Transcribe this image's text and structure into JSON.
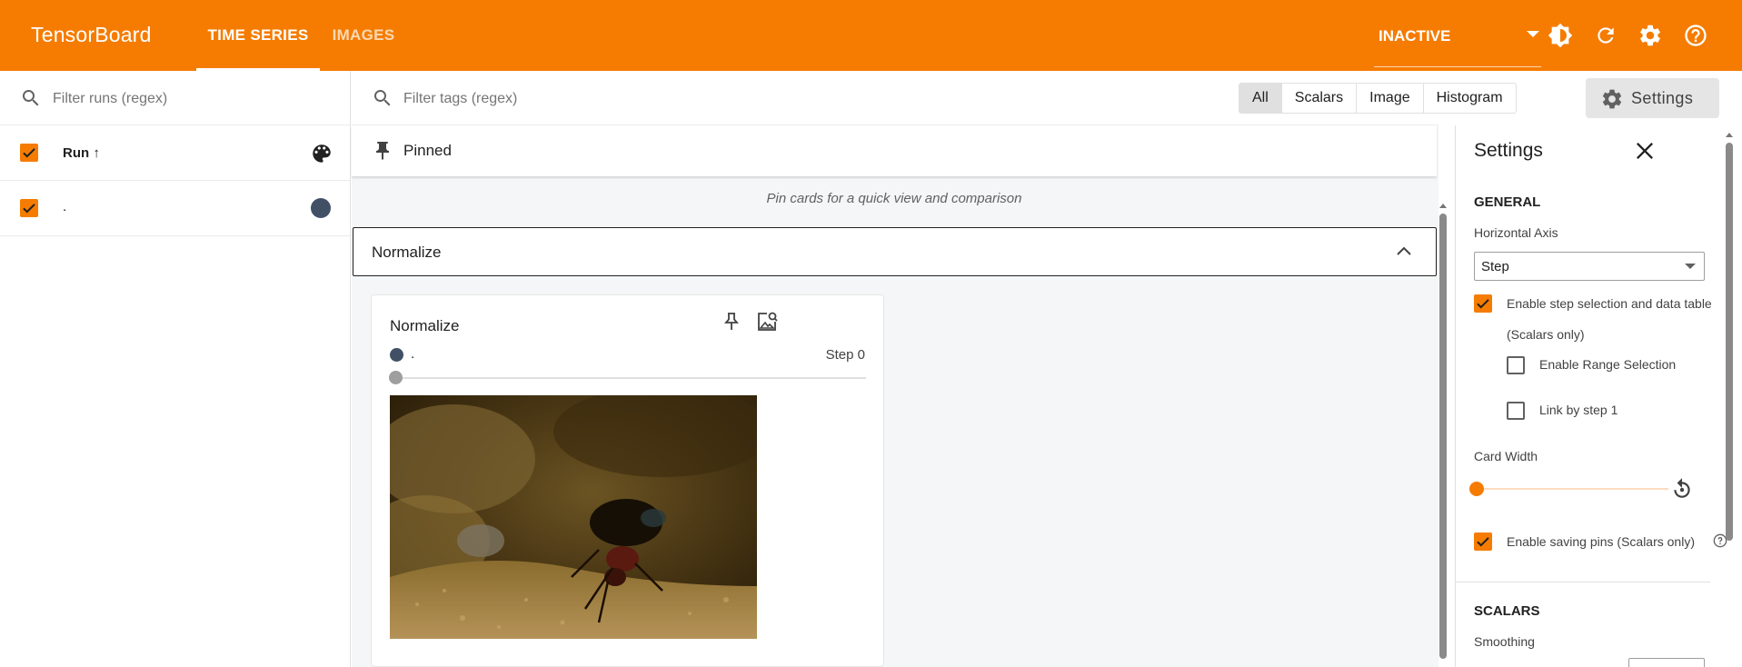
{
  "app": {
    "brand": "TensorBoard",
    "tabs": [
      {
        "label": "TIME SERIES",
        "active": true
      },
      {
        "label": "IMAGES",
        "active": false
      }
    ],
    "status": "INACTIVE",
    "icons": [
      "theme-contrast-icon",
      "refresh-icon",
      "gear-icon",
      "help-icon"
    ]
  },
  "colors": {
    "brand_orange": "#f57c00",
    "run_color": "#425066"
  },
  "runs": {
    "filter_placeholder": "Filter runs (regex)",
    "header_label": "Run ↑",
    "items": [
      {
        "name": ".",
        "checked": true
      }
    ]
  },
  "main": {
    "filter_placeholder": "Filter tags (regex)",
    "type_filters": [
      {
        "label": "All",
        "selected": true
      },
      {
        "label": "Scalars",
        "selected": false
      },
      {
        "label": "Image",
        "selected": false
      },
      {
        "label": "Histogram",
        "selected": false
      }
    ],
    "pinned_label": "Pinned",
    "pinned_empty": "Pin cards for a quick view and comparison",
    "group_label": "Normalize",
    "card": {
      "title": "Normalize",
      "run_name": ".",
      "step": "Step 0"
    }
  },
  "settings": {
    "button_label": "Settings",
    "title": "Settings",
    "general_heading": "GENERAL",
    "horizontal_axis_label": "Horizontal Axis",
    "horizontal_axis_value": "Step",
    "step_selection_label": "Enable step selection and data table",
    "scalars_only_note": "(Scalars only)",
    "range_selection_label": "Enable Range Selection",
    "link_by_step_label": "Link by step 1",
    "card_width_label": "Card Width",
    "saving_pins_label": "Enable saving pins (Scalars only)",
    "scalars_heading": "SCALARS",
    "smoothing_label": "Smoothing",
    "step_selection_checked": true,
    "range_selection_checked": false,
    "link_by_step_checked": false,
    "saving_pins_checked": true
  }
}
